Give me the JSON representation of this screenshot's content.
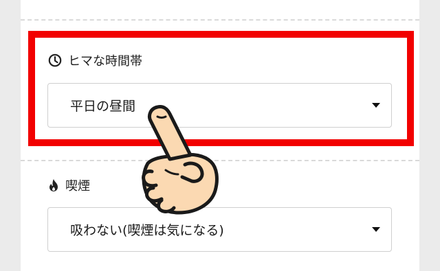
{
  "form": {
    "free_time": {
      "label": "ヒマな時間帯",
      "icon": "clock-icon",
      "selected": "平日の昼間"
    },
    "smoking": {
      "label": "喫煙",
      "icon": "flame-icon",
      "selected": "吸わない(喫煙は気になる)"
    }
  },
  "annotation": {
    "highlight_color": "#f20000",
    "pointer": "pointing-hand-icon"
  }
}
